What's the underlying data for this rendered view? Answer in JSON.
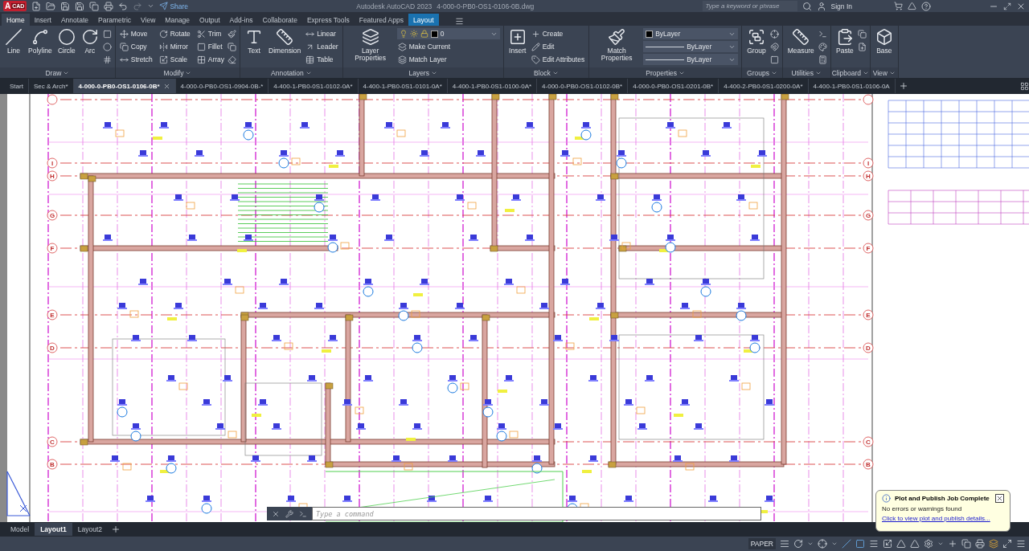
{
  "app_logo": {
    "letter": "A",
    "badge": "CAD"
  },
  "quick_access": {
    "share": "Share"
  },
  "window": {
    "app": "Autodesk AutoCAD 2023",
    "file": "4-000-0-PB0-OS1-0106-0B.dwg"
  },
  "search": {
    "placeholder": "Type a keyword or phrase"
  },
  "account": {
    "label": "Sign In"
  },
  "ribbon_tabs": [
    {
      "label": "Home",
      "selected": true,
      "kind": "standard"
    },
    {
      "label": "Insert",
      "selected": false,
      "kind": "standard"
    },
    {
      "label": "Annotate",
      "selected": false,
      "kind": "standard"
    },
    {
      "label": "Parametric",
      "selected": false,
      "kind": "standard"
    },
    {
      "label": "View",
      "selected": false,
      "kind": "standard"
    },
    {
      "label": "Manage",
      "selected": false,
      "kind": "standard"
    },
    {
      "label": "Output",
      "selected": false,
      "kind": "standard"
    },
    {
      "label": "Add-ins",
      "selected": false,
      "kind": "standard"
    },
    {
      "label": "Collaborate",
      "selected": false,
      "kind": "standard"
    },
    {
      "label": "Express Tools",
      "selected": false,
      "kind": "standard"
    },
    {
      "label": "Featured Apps",
      "selected": false,
      "kind": "standard"
    },
    {
      "label": "Layout",
      "selected": false,
      "kind": "contextual"
    }
  ],
  "panels": [
    {
      "title": "Draw",
      "large": [
        {
          "label": "Line"
        },
        {
          "label": "Polyline"
        },
        {
          "label": "Circle"
        },
        {
          "label": "Arc"
        }
      ]
    },
    {
      "title": "Modify",
      "small": [
        {
          "label": "Move"
        },
        {
          "label": "Copy"
        },
        {
          "label": "Stretch"
        },
        {
          "label": "Rotate"
        },
        {
          "label": "Mirror"
        },
        {
          "label": "Scale"
        },
        {
          "label": "Trim"
        },
        {
          "label": "Fillet"
        },
        {
          "label": "Array"
        }
      ]
    },
    {
      "title": "Annotation",
      "large": [
        {
          "label": "Text"
        },
        {
          "label": "Dimension"
        }
      ],
      "small": [
        {
          "label": "Linear"
        },
        {
          "label": "Leader"
        },
        {
          "label": "Table"
        }
      ]
    },
    {
      "title": "Layers",
      "large": [
        {
          "label": "Layer Properties"
        }
      ],
      "dropdowns": [
        {
          "kind": "layer",
          "value": "0"
        }
      ],
      "small": [
        {
          "label": "Make Current"
        },
        {
          "label": "Match Layer"
        }
      ]
    },
    {
      "title": "Block",
      "large": [
        {
          "label": "Insert"
        }
      ],
      "small": [
        {
          "label": "Create"
        },
        {
          "label": "Edit"
        },
        {
          "label": "Edit Attributes"
        }
      ]
    },
    {
      "title": "Properties",
      "large": [
        {
          "label": "Match Properties"
        }
      ],
      "dropdowns": [
        {
          "kind": "color",
          "value": "ByLayer"
        },
        {
          "kind": "line",
          "value": "ByLayer"
        },
        {
          "kind": "line",
          "value": "ByLayer"
        }
      ]
    },
    {
      "title": "Groups",
      "large": [
        {
          "label": "Group"
        }
      ]
    },
    {
      "title": "Utilities",
      "large": [
        {
          "label": "Measure"
        }
      ]
    },
    {
      "title": "Clipboard",
      "large": [
        {
          "label": "Paste"
        }
      ]
    },
    {
      "title": "View",
      "large": [
        {
          "label": "Base"
        }
      ]
    }
  ],
  "document_tabs": [
    {
      "label": "Start",
      "selected": false
    },
    {
      "label": "Sec & Arch*",
      "selected": false
    },
    {
      "label": "4-000-0-PB0-OS1-0106-0B*",
      "selected": true
    },
    {
      "label": "4-000-0-PB0-OS1-0904-0B-*",
      "selected": false
    },
    {
      "label": "4-400-1-PB0-0S1-0102-0A*",
      "selected": false
    },
    {
      "label": "4-400-1-PB0-0S1-0101-0A*",
      "selected": false
    },
    {
      "label": "4-400-1-PB0-0S1-0100-0A*",
      "selected": false
    },
    {
      "label": "4-000-0-PB0-OS1-0102-0B*",
      "selected": false
    },
    {
      "label": "4-000-0-PB0-OS1-0201-0B*",
      "selected": false
    },
    {
      "label": "4-400-2-PB0-0S1-0200-0A*",
      "selected": false
    },
    {
      "label": "4-400-1-PB0-0S1-0106-0A",
      "selected": false
    }
  ],
  "grid_bubbles": {
    "left": [
      "I",
      "H",
      "G",
      "F",
      "E",
      "D",
      "C",
      "B"
    ],
    "right": [
      "I",
      "H",
      "G",
      "F",
      "E",
      "D",
      "C",
      "B"
    ]
  },
  "command_line": {
    "placeholder": "Type a command"
  },
  "layout_tabs": [
    {
      "label": "Model",
      "selected": false
    },
    {
      "label": "Layout1",
      "selected": true
    },
    {
      "label": "Layout2",
      "selected": false
    }
  ],
  "status_bar": {
    "space": "PAPER"
  },
  "notification": {
    "title": "Plot and Publish Job Complete",
    "message": "No errors or warnings found",
    "link": "Click to view plot and publish details..."
  }
}
